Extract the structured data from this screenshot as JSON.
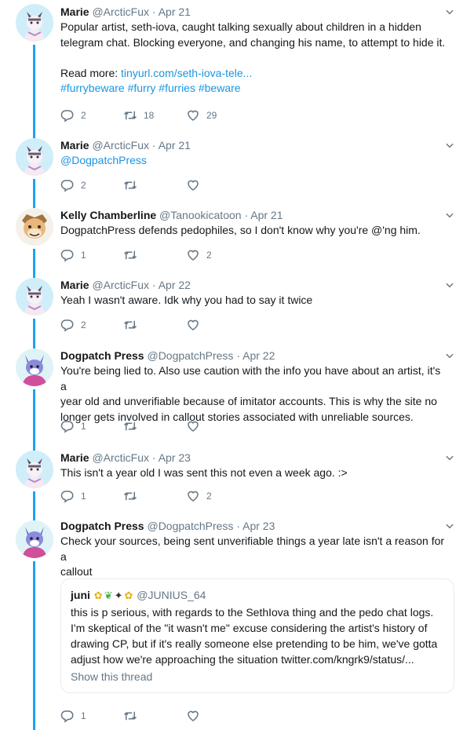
{
  "colors": {
    "accent": "#1da1f2",
    "link": "#1b95e0",
    "muted": "#657786",
    "text": "#14171a"
  },
  "icons": {
    "reply": "reply-icon",
    "retweet": "retweet-icon",
    "like": "like-icon",
    "caret": "chevron-down-icon"
  },
  "tweets": [
    {
      "name": "Marie",
      "handle": "@ArcticFux",
      "dot": "·",
      "time": "Apr 21",
      "line1": "Popular artist, seth-iova, caught talking sexually about children in a hidden",
      "line2": "telegram chat. Blocking everyone, and changing his name, to attempt to hide it.",
      "read_more_label": "Read more:",
      "read_more_link": "tinyurl.com/seth-iova-tele...",
      "hashtags": [
        "#furrybeware",
        "#furry",
        "#furries",
        "#beware"
      ],
      "replies": "2",
      "retweets": "18",
      "likes": "29"
    },
    {
      "name": "Marie",
      "handle": "@ArcticFux",
      "dot": "·",
      "time": "Apr 21",
      "mention": "@DogpatchPress",
      "replies": "2",
      "retweets": "",
      "likes": ""
    },
    {
      "name": "Kelly Chamberline",
      "handle": "@Tanookicatoon",
      "dot": "·",
      "time": "Apr 21",
      "line1": "DogpatchPress defends pedophiles, so I don't know why you're @'ng him.",
      "replies": "1",
      "retweets": "",
      "likes": "2"
    },
    {
      "name": "Marie",
      "handle": "@ArcticFux",
      "dot": "·",
      "time": "Apr 22",
      "line1": "Yeah I wasn't aware. Idk why you had to say it twice",
      "replies": "2",
      "retweets": "",
      "likes": ""
    },
    {
      "name": "Dogpatch Press",
      "handle": "@DogpatchPress",
      "dot": "·",
      "time": "Apr 22",
      "line1": "You're being lied to. Also use caution with the info you have about an artist, it's a",
      "line2": "year old and unverifiable because of imitator accounts. This is why the site no",
      "line3": "longer gets involved in callout stories associated with unreliable sources.",
      "replies": "1",
      "retweets": "",
      "likes": ""
    },
    {
      "name": "Marie",
      "handle": "@ArcticFux",
      "dot": "·",
      "time": "Apr 23",
      "line1": "This isn't a year old I was sent this not even a week ago. :>",
      "replies": "1",
      "retweets": "",
      "likes": "2"
    },
    {
      "name": "Dogpatch Press",
      "handle": "@DogpatchPress",
      "dot": "·",
      "time": "Apr 23",
      "line1": "Check your sources, being sent unverifiable things a year late isn't a reason for a",
      "line2": "callout",
      "replies": "1",
      "retweets": "",
      "likes": ""
    }
  ],
  "quote": {
    "name": "juni",
    "handle": "@JUNIUS_64",
    "line1": "this is p serious, with regards to the SethIova thing and the pedo chat logs.",
    "line2": "I'm skeptical of the \"it wasn't me\" excuse considering the artist's history of",
    "line3": "drawing CP, but if it's really someone else pretending to be him, we've gotta",
    "line4": "adjust how we're approaching the situation twitter.com/kngrk9/status/...",
    "show_thread": "Show this thread"
  }
}
